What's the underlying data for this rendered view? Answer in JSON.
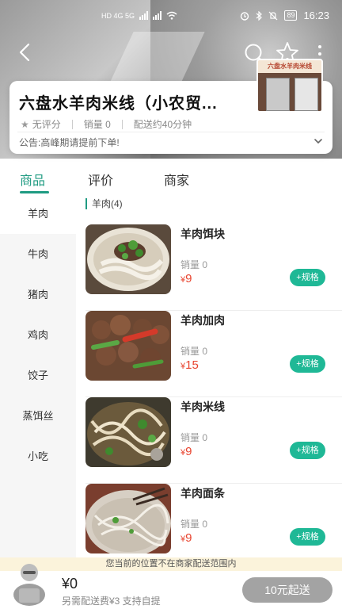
{
  "status_bar": {
    "network": "HD 4G 5G",
    "battery": "89",
    "time": "16:23"
  },
  "shop": {
    "name": "六盘水羊肉米线（小农贸...",
    "rating": "无评分",
    "sales": "销量 0",
    "delivery": "配送约40分钟",
    "notice": "公告:高峰期请提前下单!",
    "photo_sign": "六盘水羊肉米线"
  },
  "tabs": [
    "商品",
    "评价",
    "商家"
  ],
  "categories": [
    "羊肉",
    "牛肉",
    "猪肉",
    "鸡肉",
    "饺子",
    "蒸饵丝",
    "小吃"
  ],
  "section": {
    "title": "羊肉(4)"
  },
  "products": [
    {
      "name": "羊肉饵块",
      "sales": "销量 0",
      "currency": "¥",
      "price": "9",
      "spec_label": "+规格"
    },
    {
      "name": "羊肉加肉",
      "sales": "销量 0",
      "currency": "¥",
      "price": "15",
      "spec_label": "+规格"
    },
    {
      "name": "羊肉米线",
      "sales": "销量 0",
      "currency": "¥",
      "price": "9",
      "spec_label": "+规格"
    },
    {
      "name": "羊肉面条",
      "sales": "销量 0",
      "currency": "¥",
      "price": "9",
      "spec_label": "+规格"
    }
  ],
  "bottom_bar": {
    "warning": "您当前的位置不在商家配送范围内",
    "total": "¥0",
    "fee_note": "另需配送费¥3  支持自提",
    "checkout_label": "10元起送"
  },
  "colors": {
    "accent": "#1f9b82",
    "spec_button": "#1fb896",
    "price": "#e8442f",
    "checkout_disabled": "#a3a3a3",
    "warning_bg": "#fbf3db"
  },
  "icons": [
    "back-icon",
    "search-icon",
    "star-icon",
    "more-icon",
    "chevron-down-icon",
    "cart-icon"
  ]
}
